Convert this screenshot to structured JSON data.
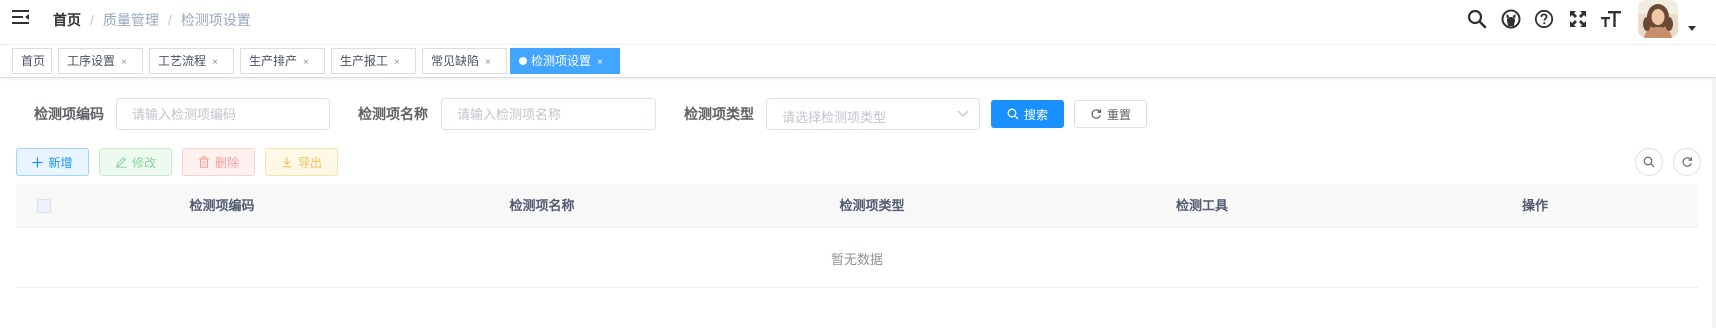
{
  "navbar": {
    "breadcrumb": [
      "首页",
      "质量管理",
      "检测项设置"
    ],
    "separator": "/",
    "icons": [
      "search-icon",
      "github-icon",
      "question-icon",
      "fullscreen-icon",
      "font-size-icon"
    ]
  },
  "tags": [
    {
      "label": "首页",
      "closable": false,
      "active": false
    },
    {
      "label": "工序设置",
      "closable": true,
      "active": false
    },
    {
      "label": "工艺流程",
      "closable": true,
      "active": false
    },
    {
      "label": "生产排产",
      "closable": true,
      "active": false
    },
    {
      "label": "生产报工",
      "closable": true,
      "active": false
    },
    {
      "label": "常见缺陷",
      "closable": true,
      "active": false
    },
    {
      "label": "检测项设置",
      "closable": true,
      "active": true
    }
  ],
  "tag_close_glyph": "×",
  "search_form": {
    "code_label": "检测项编码",
    "code_placeholder": "请输入检测项编码",
    "name_label": "检测项名称",
    "name_placeholder": "请输入检测项名称",
    "type_label": "检测项类型",
    "type_placeholder": "请选择检测项类型",
    "search_button": "搜索",
    "reset_button": "重置"
  },
  "toolbar": {
    "add": "新增",
    "edit": "修改",
    "delete": "删除",
    "export": "导出"
  },
  "table": {
    "columns": [
      "检测项编码",
      "检测项名称",
      "检测项类型",
      "检测工具",
      "操作"
    ],
    "rows": [],
    "empty_text": "暂无数据"
  },
  "colors": {
    "primary": "#1890ff",
    "active_tag": "#42a5ff",
    "success_plain": "#8bd49d",
    "danger_plain": "#f5a09c",
    "warning_plain": "#f2c061"
  }
}
